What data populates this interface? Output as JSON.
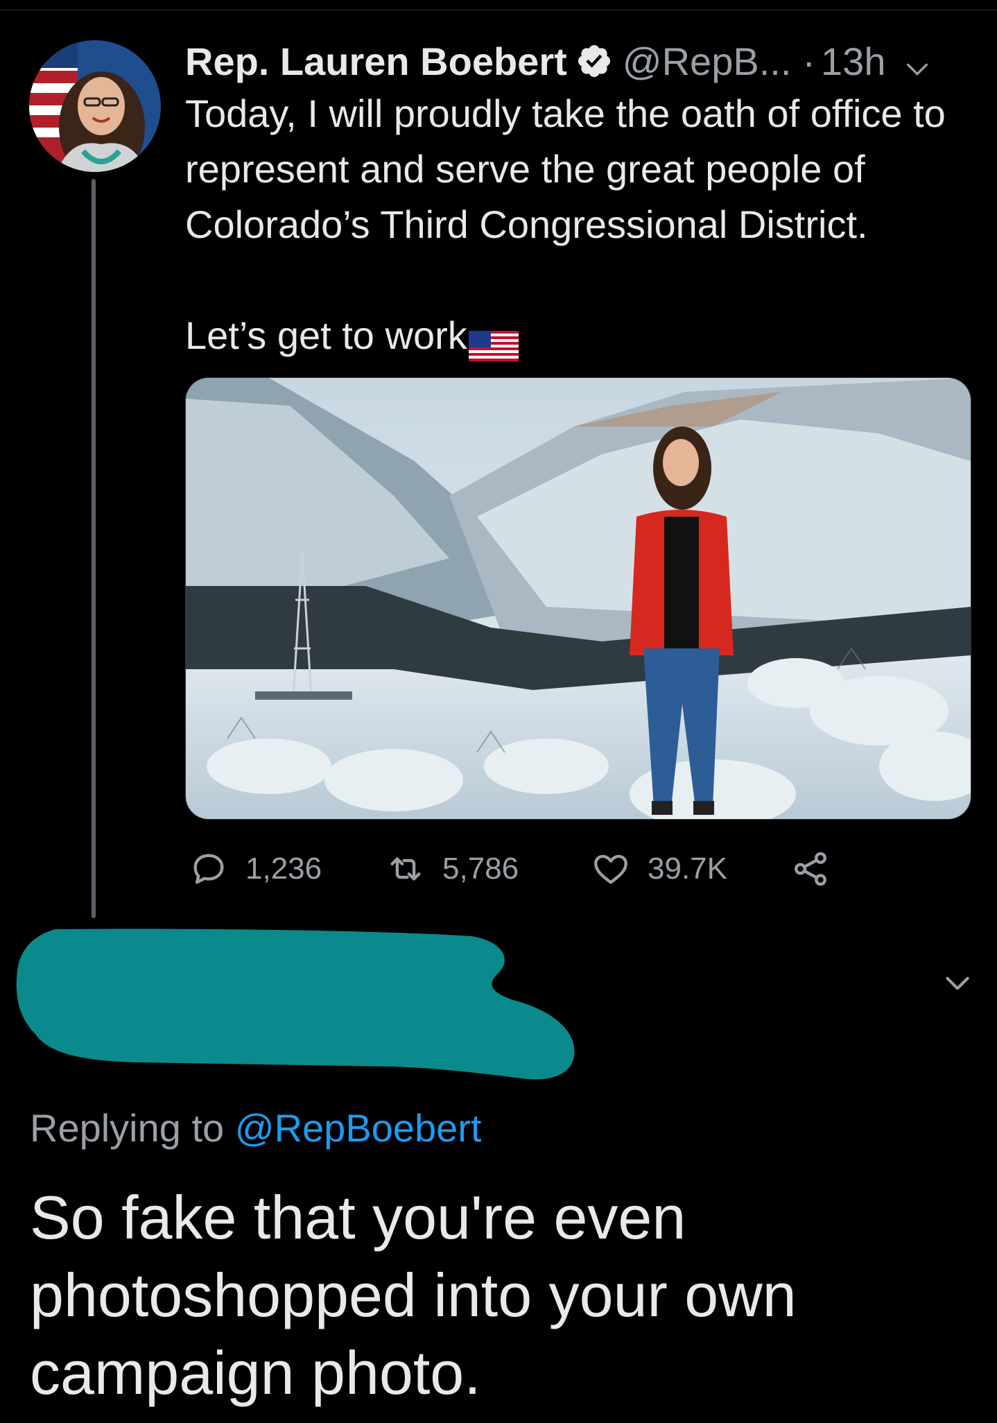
{
  "tweet": {
    "author_name": "Rep. Lauren Boebert",
    "handle": "@RepB...",
    "separator": "·",
    "time": "13h",
    "text_line1": "Today, I will proudly take the oath of office to represent and serve the great people of Colorado’s Third Congressional District.",
    "text_line2": "Let’s get to work",
    "counts": {
      "replies": "1,236",
      "retweets": "5,786",
      "likes": "39.7K"
    }
  },
  "reply": {
    "replying_prefix": "Replying to ",
    "replying_handle": "@RepBoebert",
    "text": "So fake that you're even photoshopped into your own campaign photo."
  },
  "colors": {
    "background": "#000000",
    "text": "#e7e9ea",
    "muted": "#9aa0a6",
    "link": "#1d9bf0",
    "redaction": "#0a8a8c"
  },
  "icons": [
    "verified-badge-icon",
    "chevron-down-icon",
    "us-flag-icon",
    "reply-icon",
    "retweet-icon",
    "like-icon",
    "share-icon"
  ]
}
